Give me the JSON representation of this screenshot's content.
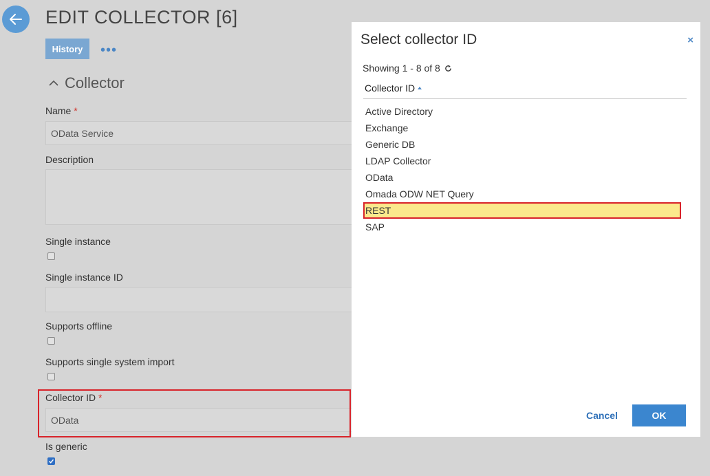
{
  "page": {
    "title": "EDIT COLLECTOR [6]",
    "history_label": "History",
    "more_label": "•••",
    "section_title": "Collector"
  },
  "form": {
    "name_label": "Name",
    "name_value": "OData Service",
    "description_label": "Description",
    "single_instance_label": "Single instance",
    "single_instance_id_label": "Single instance ID",
    "supports_offline_label": "Supports offline",
    "supports_single_system_import_label": "Supports single system import",
    "collector_id_label": "Collector ID",
    "collector_id_value": "OData",
    "is_generic_label": "Is generic",
    "required_mark": "*",
    "is_generic_checked": true
  },
  "modal": {
    "title": "Select collector ID",
    "close_label": "×",
    "showing": "Showing 1 - 8 of 8",
    "column_header": "Collector ID",
    "items": [
      "Active Directory",
      "Exchange",
      "Generic DB",
      "LDAP Collector",
      "OData",
      "Omada ODW NET Query",
      "REST",
      "SAP"
    ],
    "selected_index": 6,
    "cancel_label": "Cancel",
    "ok_label": "OK"
  },
  "colors": {
    "accent": "#3b86cf",
    "highlight": "#fbe98c",
    "annotation_red": "#d8232a"
  }
}
